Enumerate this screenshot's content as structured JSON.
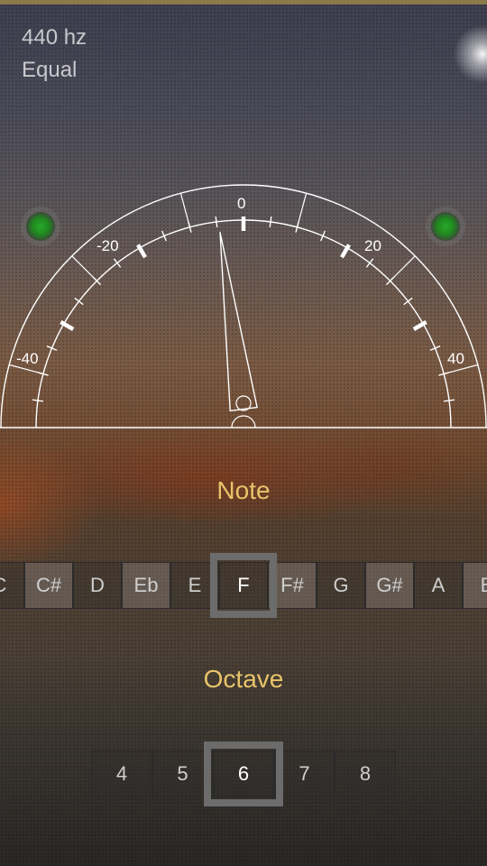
{
  "header": {
    "reference_frequency": "440 hz",
    "temperament": "Equal"
  },
  "meter": {
    "scale_labels": [
      "-40",
      "-20",
      "0",
      "20",
      "40"
    ],
    "needle_cents": -3,
    "left_indicator_color": "#1e8a1e",
    "right_indicator_color": "#1e8a1e"
  },
  "note_section": {
    "title": "Note",
    "notes": [
      "C",
      "C#",
      "D",
      "Eb",
      "E",
      "F",
      "F#",
      "G",
      "G#",
      "A",
      "B"
    ],
    "selected": "F"
  },
  "octave_section": {
    "title": "Octave",
    "octaves": [
      "4",
      "5",
      "6",
      "7",
      "8"
    ],
    "selected": "6"
  },
  "colors": {
    "accent": "#e8c46a",
    "top_bar": "#8a7a4a",
    "indicator_green": "#1e8a1e"
  }
}
